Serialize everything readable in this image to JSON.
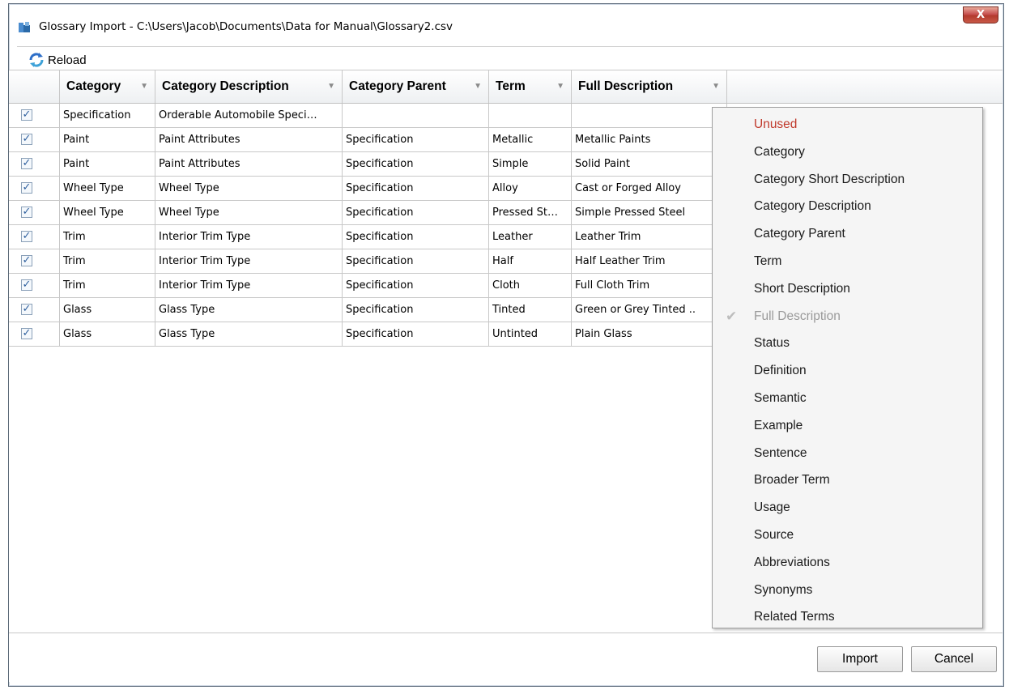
{
  "window": {
    "title": "Glossary Import - C:\\Users\\Jacob\\Documents\\Data for Manual\\Glossary2.csv",
    "close_label": "X"
  },
  "toolbar": {
    "reload_label": "Reload"
  },
  "columns": [
    "Category",
    "Category Description",
    "Category Parent",
    "Term",
    "Full Description"
  ],
  "rows": [
    {
      "checked": true,
      "cells": [
        "Specification",
        "Orderable Automobile Speci…",
        "",
        "",
        ""
      ]
    },
    {
      "checked": true,
      "cells": [
        "Paint",
        "Paint Attributes",
        "Specification",
        "Metallic",
        "Metallic Paints"
      ]
    },
    {
      "checked": true,
      "cells": [
        "Paint",
        "Paint Attributes",
        "Specification",
        "Simple",
        "Solid Paint"
      ]
    },
    {
      "checked": true,
      "cells": [
        "Wheel Type",
        "Wheel Type",
        "Specification",
        "Alloy",
        "Cast or Forged Alloy"
      ]
    },
    {
      "checked": true,
      "cells": [
        "Wheel Type",
        "Wheel Type",
        "Specification",
        "Pressed St…",
        "Simple Pressed Steel"
      ]
    },
    {
      "checked": true,
      "cells": [
        "Trim",
        "Interior Trim Type",
        "Specification",
        "Leather",
        "Leather Trim"
      ]
    },
    {
      "checked": true,
      "cells": [
        "Trim",
        "Interior Trim Type",
        "Specification",
        "Half",
        "Half Leather Trim"
      ]
    },
    {
      "checked": true,
      "cells": [
        "Trim",
        "Interior Trim Type",
        "Specification",
        "Cloth",
        "Full Cloth Trim"
      ]
    },
    {
      "checked": true,
      "cells": [
        "Glass",
        "Glass Type",
        "Specification",
        "Tinted",
        "Green or Grey Tinted .."
      ]
    },
    {
      "checked": true,
      "cells": [
        "Glass",
        "Glass Type",
        "Specification",
        "Untinted",
        "Plain Glass"
      ]
    }
  ],
  "menu": {
    "items": [
      {
        "label": "Unused",
        "style": "unused"
      },
      {
        "label": "Category"
      },
      {
        "label": "Category Short Description"
      },
      {
        "label": "Category Description"
      },
      {
        "label": "Category Parent"
      },
      {
        "label": "Term"
      },
      {
        "label": "Short Description"
      },
      {
        "label": "Full Description",
        "style": "disabled",
        "checked": true
      },
      {
        "label": "Status"
      },
      {
        "label": "Definition"
      },
      {
        "label": "Semantic"
      },
      {
        "label": "Example"
      },
      {
        "label": "Sentence"
      },
      {
        "label": "Broader Term"
      },
      {
        "label": "Usage"
      },
      {
        "label": "Source"
      },
      {
        "label": "Abbreviations"
      },
      {
        "label": "Synonyms"
      },
      {
        "label": "Related Terms"
      }
    ]
  },
  "footer": {
    "import_label": "Import",
    "cancel_label": "Cancel"
  },
  "colors": {
    "accent": "#2e6fc8",
    "unused": "#c0392b",
    "close": "#c75050"
  },
  "icons": {
    "app": "database-icon",
    "reload": "refresh-icon",
    "check": "checkmark-icon"
  }
}
